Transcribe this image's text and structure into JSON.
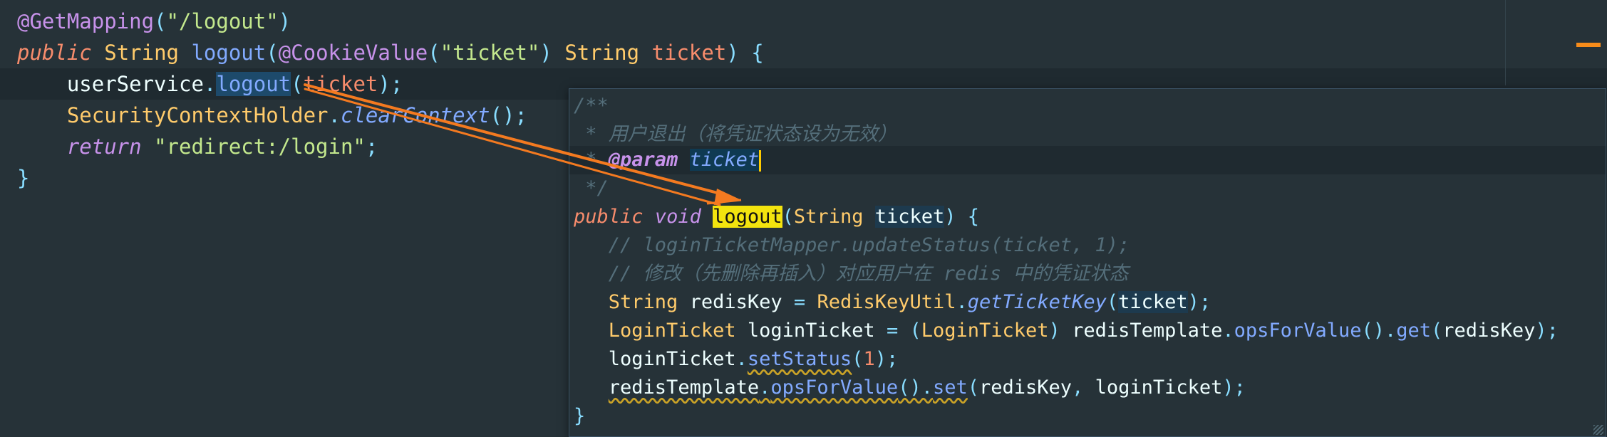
{
  "editor": {
    "mapping_annotation": "@GetMapping",
    "mapping_path": "\"/logout\"",
    "kw_public": "public",
    "return_type": "String",
    "method_name": "logout",
    "cookie_annotation": "@CookieValue",
    "cookie_name": "\"ticket\"",
    "param_type": "String",
    "param_name": "ticket",
    "service_var": "userService",
    "service_call": "logout",
    "service_arg": "ticket",
    "holder_class": "SecurityContextHolder",
    "holder_method": "clearContext",
    "kw_return": "return",
    "redirect": "\"redirect:/login\""
  },
  "popup": {
    "doc_open": "/**",
    "doc_desc": " * 用户退出（将凭证状态设为无效）",
    "doc_star": " * ",
    "doc_tag": "@param",
    "doc_param": "ticket",
    "doc_close": " */",
    "kw_public": "public",
    "kw_void": "void",
    "method_name": "logout",
    "param_type": "String",
    "param_name": "ticket",
    "comment1": "// loginTicketMapper.updateStatus(ticket, 1);",
    "comment2": "// 修改（先删除再插入）对应用户在 redis 中的凭证状态",
    "l3_type": "String",
    "l3_var": "redisKey",
    "l3_class": "RedisKeyUtil",
    "l3_method": "getTicketKey",
    "l3_arg": "ticket",
    "l4_type": "LoginTicket",
    "l4_var": "loginTicket",
    "l4_cast": "LoginTicket",
    "l4_obj": "redisTemplate",
    "l4_m1": "opsForValue",
    "l4_m2": "get",
    "l4_arg": "redisKey",
    "l5_var": "loginTicket",
    "l5_method": "setStatus",
    "l5_arg": "1",
    "l6_obj": "redisTemplate",
    "l6_m1": "opsForValue",
    "l6_m2": "set",
    "l6_arg1": "redisKey",
    "l6_arg2": "loginTicket"
  },
  "colors": {
    "background": "#263238",
    "annotation": "#c792ea",
    "keyword": "#f78c6c",
    "string": "#c3e88d",
    "type": "#ffcb6b",
    "function": "#82aaff",
    "comment": "#546e7a",
    "highlight": "#f3e40e",
    "arrow": "#f47a20"
  }
}
